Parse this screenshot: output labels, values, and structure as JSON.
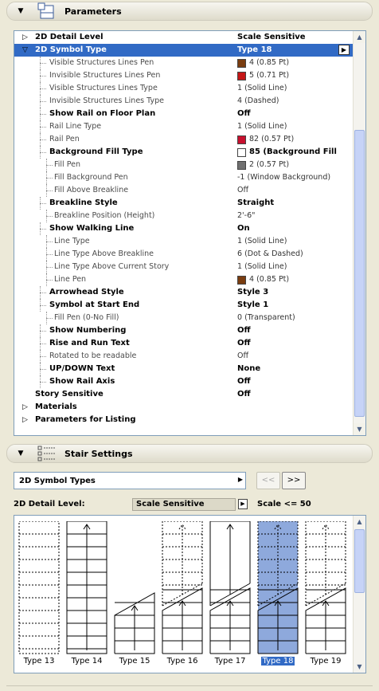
{
  "parameters_header": {
    "title": "Parameters",
    "collapse_icon": "triangle-down-icon",
    "section_icon": "parameters-page-icon"
  },
  "params": [
    {
      "label": "2D Detail Level",
      "value": "Scale Sensitive",
      "bold": true,
      "indent": 0,
      "expander": "right"
    },
    {
      "label": "2D Symbol Type",
      "value": "Type 18",
      "bold": true,
      "indent": 0,
      "expander": "down",
      "selected": true
    },
    {
      "label": "Visible Structures Lines Pen",
      "value": "4 (0.85 Pt)",
      "indent": 1,
      "swatch": "#7a3d10"
    },
    {
      "label": "Invisible Structures Lines Pen",
      "value": "5 (0.71 Pt)",
      "indent": 1,
      "swatch": "#c51616"
    },
    {
      "label": "Visible Structures Lines Type",
      "value": "1 (Solid Line)",
      "indent": 1
    },
    {
      "label": "Invisible Structures Lines Type",
      "value": "4 (Dashed)",
      "indent": 1
    },
    {
      "label": "Show Rail on Floor Plan",
      "value": "Off",
      "bold": true,
      "indent": 1
    },
    {
      "label": "Rail Line Type",
      "value": "1 (Solid Line)",
      "indent": 1
    },
    {
      "label": "Rail Pen",
      "value": "82 (0.57 Pt)",
      "indent": 1,
      "swatch": "#c8102e"
    },
    {
      "label": "Background Fill Type",
      "value": "85 (Background Fill",
      "bold": true,
      "indent": 1,
      "swatch": "#ffffff"
    },
    {
      "label": "Fill Pen",
      "value": "2 (0.57 Pt)",
      "indent": 2,
      "swatch": "#707070"
    },
    {
      "label": "Fill Background Pen",
      "value": "-1 (Window Background)",
      "indent": 2
    },
    {
      "label": "Fill Above Breakline",
      "value": "Off",
      "indent": 2
    },
    {
      "label": "Breakline Style",
      "value": "Straight",
      "bold": true,
      "indent": 1
    },
    {
      "label": "Breakline Position (Height)",
      "value": "2'-6\"",
      "indent": 2
    },
    {
      "label": "Show Walking Line",
      "value": "On",
      "bold": true,
      "indent": 1
    },
    {
      "label": "Line Type",
      "value": "1 (Solid Line)",
      "indent": 2
    },
    {
      "label": "Line Type Above Breakline",
      "value": "6 (Dot & Dashed)",
      "indent": 2
    },
    {
      "label": "Line Type Above Current Story",
      "value": "1 (Solid Line)",
      "indent": 2
    },
    {
      "label": "Line Pen",
      "value": "4 (0.85 Pt)",
      "indent": 2,
      "swatch": "#7a3d10"
    },
    {
      "label": "Arrowhead Style",
      "value": "Style 3",
      "bold": true,
      "indent": 1
    },
    {
      "label": "Symbol at Start End",
      "value": "Style 1",
      "bold": true,
      "indent": 1
    },
    {
      "label": "Fill Pen (0-No Fill)",
      "value": "0 (Transparent)",
      "indent": 2
    },
    {
      "label": "Show Numbering",
      "value": "Off",
      "bold": true,
      "indent": 1
    },
    {
      "label": "Rise and Run Text",
      "value": "Off",
      "bold": true,
      "indent": 1
    },
    {
      "label": "Rotated to be readable",
      "value": "Off",
      "indent": 1
    },
    {
      "label": "UP/DOWN Text",
      "value": "None",
      "bold": true,
      "indent": 1
    },
    {
      "label": "Show Rail Axis",
      "value": "Off",
      "bold": true,
      "indent": 1
    },
    {
      "label": "Story Sensitive",
      "value": "Off",
      "bold": true,
      "indent": 0,
      "expander": "none"
    },
    {
      "label": "Materials",
      "value": "",
      "bold": true,
      "indent": 0,
      "expander": "right"
    },
    {
      "label": "Parameters for Listing",
      "value": "",
      "bold": true,
      "indent": 0,
      "expander": "right"
    }
  ],
  "stair_header": {
    "title": "Stair Settings",
    "collapse_icon": "triangle-down-icon",
    "section_icon": "stair-settings-icon"
  },
  "symbol_types_dropdown": {
    "value": "2D Symbol Types"
  },
  "nav": {
    "prev": "<<",
    "next": ">>"
  },
  "detail": {
    "label": "2D Detail Level:",
    "value": "Scale Sensitive",
    "scale": "Scale <= 50"
  },
  "gallery": [
    {
      "caption": "Type 13",
      "variant": "dashed-full"
    },
    {
      "caption": "Type 14",
      "variant": "solid-full-arrow"
    },
    {
      "caption": "Type 15",
      "variant": "break-low"
    },
    {
      "caption": "Type 16",
      "variant": "break-dashed-top"
    },
    {
      "caption": "Type 17",
      "variant": "break-solid-top"
    },
    {
      "caption": "Type 18",
      "variant": "break-selected",
      "selected": true
    },
    {
      "caption": "Type 19",
      "variant": "break-dashed-top"
    }
  ]
}
